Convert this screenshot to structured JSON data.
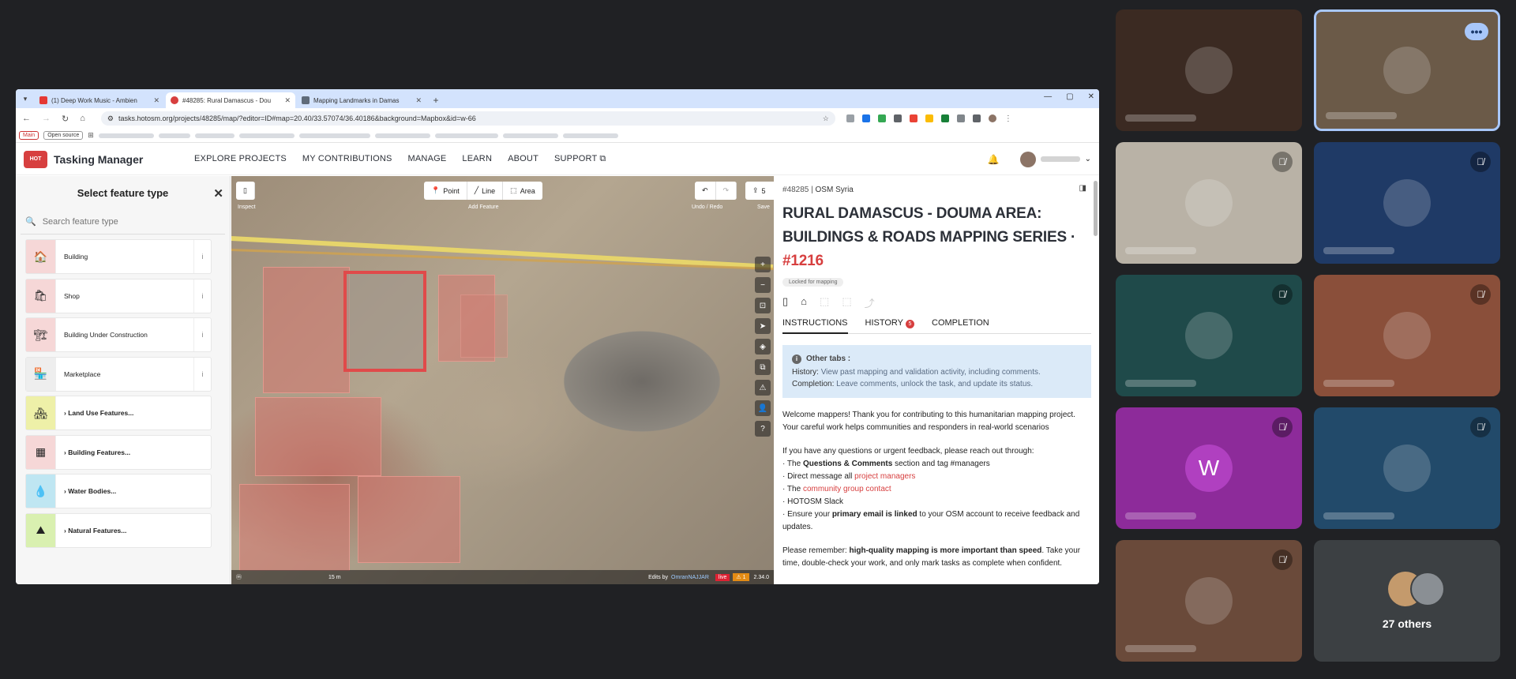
{
  "browser": {
    "tabs": [
      {
        "title": "(1) Deep Work Music - Ambien",
        "favcolor": "#e53935"
      },
      {
        "title": "#48285: Rural Damascus - Dou",
        "favcolor": "#d73f3f"
      },
      {
        "title": "Mapping Landmarks in Damas",
        "favcolor": "#5f6b7a"
      }
    ],
    "url": "tasks.hotosm.org/projects/48285/map/?editor=ID#map=20.40/33.57074/36.40186&background=Mapbox&id=w-66",
    "bookmarks": {
      "main": "Main",
      "open_source": "Open source"
    }
  },
  "header": {
    "logo_text": "HOT",
    "brand": "Tasking Manager",
    "nav": [
      "EXPLORE PROJECTS",
      "MY CONTRIBUTIONS",
      "MANAGE",
      "LEARN",
      "ABOUT",
      "SUPPORT ⧉"
    ]
  },
  "feature_panel": {
    "title": "Select feature type",
    "search_placeholder": "Search feature type",
    "items": [
      {
        "label": "Building",
        "icon": "🏠",
        "bg": "#f6d7d7",
        "info": "i"
      },
      {
        "label": "Shop",
        "icon": "🛍",
        "bg": "#f6d7d7",
        "info": "i"
      },
      {
        "label": "Building Under Construction",
        "icon": "🏗",
        "bg": "#f6d7d7",
        "info": "i"
      },
      {
        "label": "Marketplace",
        "icon": "🏪",
        "bg": "#eeeeee",
        "info": "i"
      },
      {
        "label": "› Land Use Features...",
        "icon": "🏘",
        "bg": "#eef0a8",
        "info": ""
      },
      {
        "label": "› Building Features...",
        "icon": "▦",
        "bg": "#f6d7d7",
        "info": ""
      },
      {
        "label": "› Water Bodies...",
        "icon": "💧",
        "bg": "#bfe6f2",
        "info": ""
      },
      {
        "label": "› Natural Features...",
        "icon": "⛰",
        "bg": "#d9f0b0",
        "info": ""
      }
    ]
  },
  "map": {
    "tools": [
      {
        "icon": "📍",
        "label": "Point"
      },
      {
        "icon": "╱",
        "label": "Line"
      },
      {
        "icon": "⬚",
        "label": "Area"
      }
    ],
    "inspect_label": "Inspect",
    "add_feature_label": "Add Feature",
    "undo_redo_label": "Undo / Redo",
    "save_label": "Save",
    "save_count": "5",
    "scale": "15 m",
    "edits_by": "Edits by",
    "editor": "OmranNAJJAR",
    "live": "live",
    "warnings": "⚠ 1",
    "version": "2.34.0"
  },
  "instructions": {
    "project_id": "#48285",
    "org": "OSM Syria",
    "title": "RURAL DAMASCUS - DOUMA AREA: BUILDINGS & ROADS MAPPING SERIES · ",
    "title_num": "#1216",
    "stat": "Locked for mapping",
    "tabs": {
      "instructions": "INSTRUCTIONS",
      "history": "HISTORY",
      "history_count": "5",
      "completion": "COMPLETION"
    },
    "other_tabs": {
      "heading": "Other tabs :",
      "history_label": "History:",
      "history_text": "View past mapping and validation activity, including comments.",
      "completion_label": "Completion:",
      "completion_text": "Leave comments, unlock the task, and update its status."
    },
    "welcome": "Welcome mappers! Thank you for contributing to this humanitarian mapping project. Your careful work helps communities and responders in real-world scenarios",
    "questions_intro": "If you have any questions or urgent feedback, please reach out through:",
    "q_line1_pre": "· The ",
    "q_line1_bold": "Questions & Comments",
    "q_line1_post": " section and tag #managers",
    "q_line2_pre": "· Direct message all ",
    "q_line2_link": "project managers",
    "q_line3_pre": "· The ",
    "q_line3_link": "community group contact",
    "q_line4": "· HOTOSM Slack",
    "q_line5_pre": "· Ensure your ",
    "q_line5_bold": "primary email is linked",
    "q_line5_post": " to your OSM account to receive feedback and updates.",
    "remember_pre": "Please remember: ",
    "remember_bold": "high-quality mapping is more important than speed",
    "remember_post": ". Take your time, double-check your work, and only mark tasks as complete when confident."
  },
  "meeting": {
    "tiles": [
      {
        "bg": "#3b2a22",
        "muted": false,
        "initial": ""
      },
      {
        "bg": "#6b5a48",
        "muted": false,
        "initial": "",
        "highlight": true
      },
      {
        "bg": "#b9b2a6",
        "muted": true,
        "initial": ""
      },
      {
        "bg": "#1f3a66",
        "muted": true,
        "initial": ""
      },
      {
        "bg": "#1f4a4a",
        "muted": true,
        "initial": ""
      },
      {
        "bg": "#8a4f3a",
        "muted": true,
        "initial": ""
      },
      {
        "bg": "#8d2b9a",
        "muted": true,
        "initial": "W"
      },
      {
        "bg": "#224a6a",
        "muted": true,
        "initial": ""
      },
      {
        "bg": "#6a4a3a",
        "muted": true,
        "initial": ""
      }
    ],
    "others_label": "27 others",
    "more_options": "•••"
  }
}
